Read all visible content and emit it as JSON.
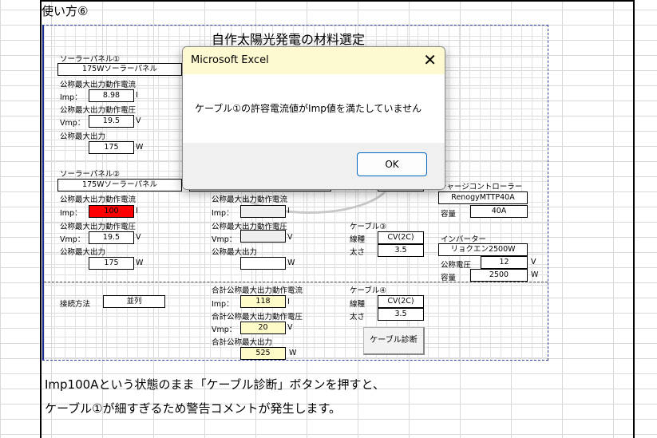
{
  "heading": "使い方⑥",
  "sheet": {
    "title": "自作太陽光発電の材料選定",
    "panel1": {
      "section": "ソーラーパネル①",
      "model": "175Wソーラーパネル",
      "imp_label": "公称最大出力動作電流",
      "imp_key": "Imp：",
      "imp": "8.98",
      "imp_unit": "I",
      "vmp_label": "公称最大出力動作電圧",
      "vmp_key": "Vmp：",
      "vmp": "19.5",
      "vmp_unit": "V",
      "p_label": "公称最大出力",
      "p": "175",
      "p_unit": "W"
    },
    "panel2": {
      "section": "ソーラーパネル②",
      "model": "175Wソーラーパネル",
      "imp_label": "公称最大出力動作電流",
      "imp_key": "Imp：",
      "imp": "100",
      "imp_unit": "I",
      "vmp_label": "公称最大出力動作電圧",
      "vmp_key": "Vmp：",
      "vmp": "19.5",
      "vmp_unit": "V",
      "p_label": "公称最大出力",
      "p": "175",
      "p_unit": "W"
    },
    "panel3": {
      "imp_label": "公称最大出力動作電流",
      "imp_key": "Imp：",
      "imp_unit": "I",
      "vmp_label": "公称最大出力動作電圧",
      "vmp_key": "Vmp：",
      "vmp_unit": "V",
      "p_label": "公称最大出力",
      "p_unit": "W"
    },
    "cable3": {
      "section": "ケーブル③",
      "type_label": "線種",
      "type": "CV(2C)",
      "size_label": "太さ",
      "size": "3.5"
    },
    "cable4": {
      "section": "ケーブル④",
      "type_label": "線種",
      "type": "CV(2C)",
      "size_label": "太さ",
      "size": "3.5"
    },
    "charge": {
      "section": "チャージコントローラー",
      "model": "RenogyMTTP40A",
      "cap_label": "容量",
      "cap": "40A"
    },
    "inverter": {
      "section": "インバーター",
      "model": "リョクエン2500W",
      "volt_label": "公称電圧",
      "volt": "12",
      "volt_unit": "V",
      "cap_label": "容量",
      "cap": "2500",
      "cap_unit": "W"
    },
    "connection": {
      "label": "接続方法",
      "value": "並列"
    },
    "total": {
      "imp_label": "合計公称最大出力動作電流",
      "imp_key": "Imp：",
      "imp": "118",
      "imp_unit": "I",
      "vmp_label": "合計公称最大出力動作電圧",
      "vmp_key": "Vmp：",
      "vmp": "20",
      "vmp_unit": "V",
      "p_label": "合計公称最大出力",
      "p": "525",
      "p_unit": "W"
    },
    "diag_button": "ケーブル診断"
  },
  "dialog": {
    "title": "Microsoft Excel",
    "message": "ケーブル①の許容電流値がImp値を満たしていません",
    "ok": "OK",
    "close": "✕"
  },
  "caption": {
    "line1": "Imp100Aという状態のまま「ケーブル診断」ボタンを押すと、",
    "line2": "ケーブル①が細すぎるため警告コメントが発生します。"
  }
}
